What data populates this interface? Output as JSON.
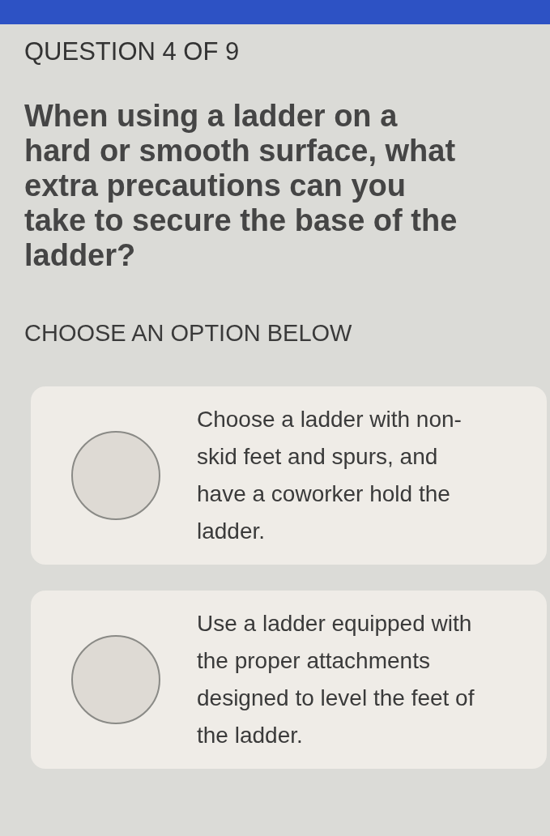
{
  "header": {
    "counter": "QUESTION 4 OF 9"
  },
  "question": {
    "text": "When using a ladder on a hard or smooth surface, what extra precautions can you take to secure the base of the ladder?",
    "instruction": "CHOOSE AN OPTION BELOW"
  },
  "options": [
    {
      "text": "Choose a ladder with non-skid feet and spurs, and have a coworker hold the ladder.",
      "selected": false
    },
    {
      "text": "Use a ladder equipped with the proper attachments designed to level the feet of the ladder.",
      "selected": false
    }
  ]
}
